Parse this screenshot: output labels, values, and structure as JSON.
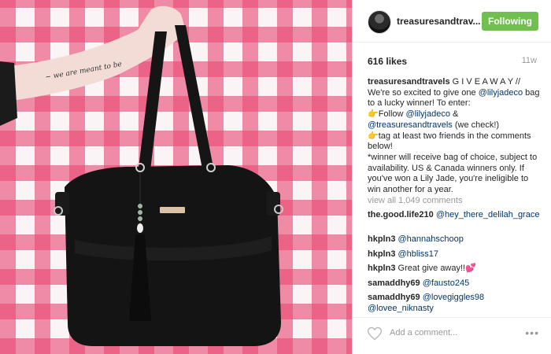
{
  "post": {
    "image_alt": "black leather bag with tassel held up against pink gingham",
    "author": "treasuresandtrav...",
    "follow_label": "Following",
    "likes": "616 likes",
    "age": "11w",
    "caption": {
      "author": "treasuresandtravels",
      "line1": " G I V E A W A Y // We're so excited to give one ",
      "mention1": "@lilyjadeco",
      "line2": " bag to a lucky winner! To enter:",
      "step1_emoji": "👉",
      "step1_text": "Follow ",
      "mention2": "@lilyjadeco",
      "step1_amp": " &",
      "mention3": "@treasuresandtravels",
      "step1_end": " (we check!)",
      "step2_emoji": "👉",
      "step2_text": "tag at least two friends in the comments below!",
      "rules": "*winner will receive bag of choice, subject to availability. US & Canada winners only. If you've won a Lily Jade, you're ineligible to win another for a year."
    },
    "view_all": "view all 1,049 comments",
    "comments": [
      {
        "user": "the.good.life210",
        "mention": "@hey_there_delilah_grace",
        "text": ""
      },
      {
        "user": "hkpln3",
        "mention": "@hannahschoop",
        "text": ""
      },
      {
        "user": "hkpln3",
        "mention": "@hbliss17",
        "text": ""
      },
      {
        "user": "hkpln3",
        "mention": "",
        "text": "Great give away!!",
        "emoji": "💕"
      },
      {
        "user": "samaddhy69",
        "mention": "@fausto245",
        "text": ""
      },
      {
        "user": "samaddhy69",
        "mention": "@lovegiggles98",
        "text": "",
        "mention2": "@lovee_niknasty"
      }
    ],
    "add_comment_placeholder": "Add a comment...",
    "more_label": "•••",
    "colors": {
      "follow_green": "#70c050",
      "link_blue": "#003569",
      "gingham_pink": "#e84a74"
    }
  }
}
